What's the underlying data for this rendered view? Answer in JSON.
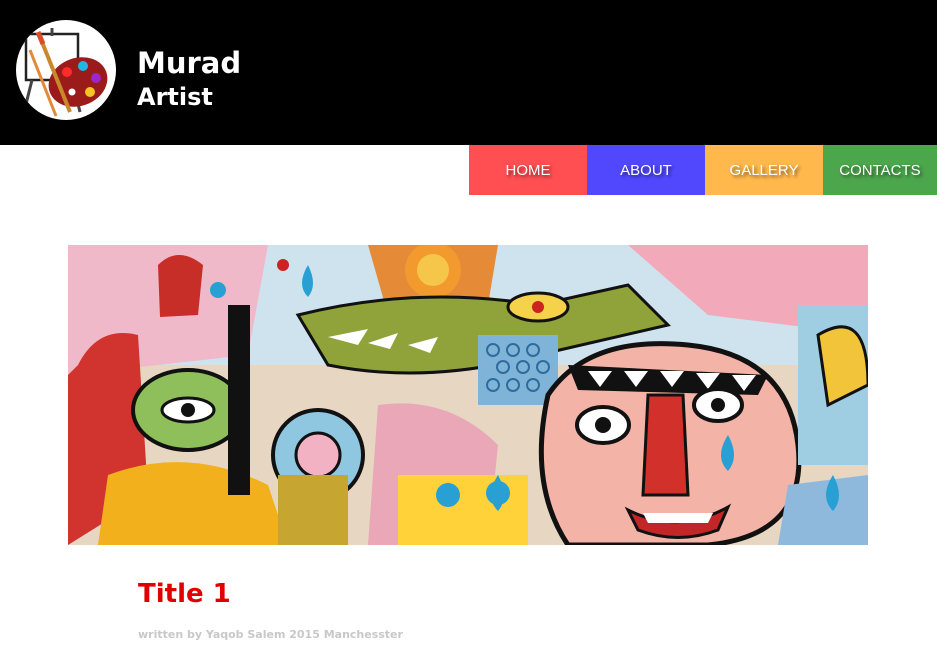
{
  "header": {
    "brand_name": "Murad",
    "brand_sub": "Artist",
    "logo_icon": "palette-easel-icon"
  },
  "nav": {
    "items": [
      {
        "label": "HOME",
        "color": "#ff4f52"
      },
      {
        "label": "ABOUT",
        "color": "#5148fe"
      },
      {
        "label": "GALLERY",
        "color": "#ffb84c"
      },
      {
        "label": "CONTACTS",
        "color": "#4ca64c"
      }
    ]
  },
  "hero": {
    "image": "graffiti-artwork"
  },
  "post": {
    "title": "Title 1",
    "meta": "written by Yaqob Salem 2015 Manchesster"
  },
  "colors": {
    "header_bg": "#000000",
    "title": "#e00000",
    "meta": "#c8c8c8"
  }
}
